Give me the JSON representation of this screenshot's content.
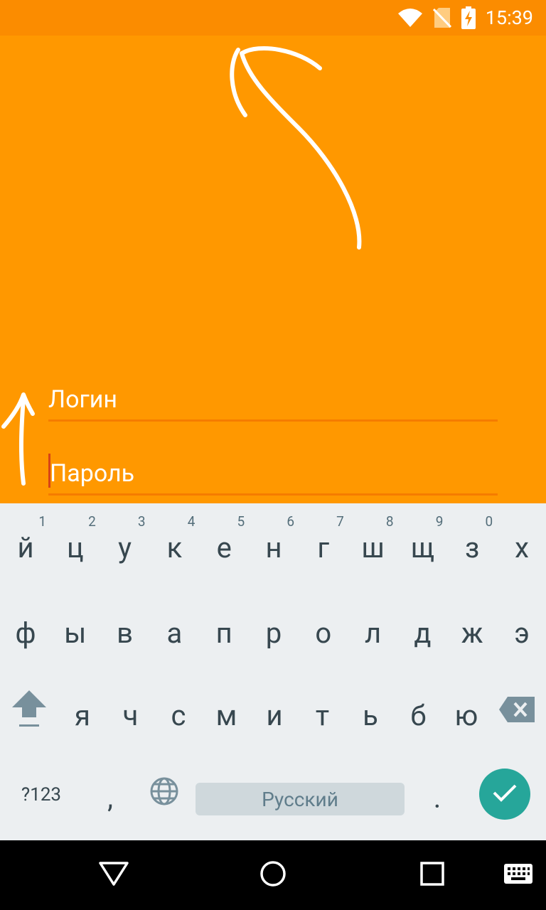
{
  "status_bar": {
    "time": "15:39",
    "icons": [
      "wifi-icon",
      "no-sim-icon",
      "battery-charging-icon"
    ]
  },
  "form": {
    "login_placeholder": "Логин",
    "password_placeholder": "Пароль"
  },
  "keyboard": {
    "row1": [
      {
        "key": "й",
        "hint": "1"
      },
      {
        "key": "ц",
        "hint": "2"
      },
      {
        "key": "у",
        "hint": "3"
      },
      {
        "key": "к",
        "hint": "4"
      },
      {
        "key": "е",
        "hint": "5"
      },
      {
        "key": "н",
        "hint": "6"
      },
      {
        "key": "г",
        "hint": "7"
      },
      {
        "key": "ш",
        "hint": "8"
      },
      {
        "key": "щ",
        "hint": "9"
      },
      {
        "key": "з",
        "hint": "0"
      },
      {
        "key": "х",
        "hint": ""
      }
    ],
    "row2": [
      "ф",
      "ы",
      "в",
      "а",
      "п",
      "р",
      "о",
      "л",
      "д",
      "ж",
      "э"
    ],
    "row3": [
      "я",
      "ч",
      "с",
      "м",
      "и",
      "т",
      "ь",
      "б",
      "ю"
    ],
    "symbols_label": "?123",
    "comma": ",",
    "period": ".",
    "space_label": "Русский",
    "icons": [
      "shift-icon",
      "backspace-icon",
      "globe-icon",
      "checkmark-icon"
    ],
    "accent_color": "#26a69a"
  },
  "nav_bar": {
    "icons": [
      "back-icon",
      "home-icon",
      "recents-icon",
      "keyboard-icon"
    ]
  },
  "colors": {
    "app_background": "#ff9800",
    "status_bar": "#fb8c00"
  }
}
